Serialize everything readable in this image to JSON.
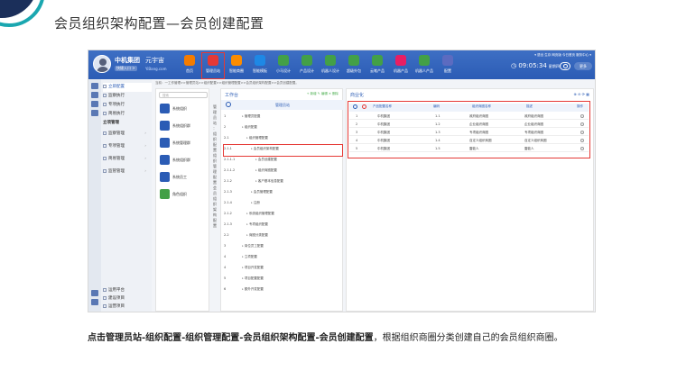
{
  "slide": {
    "title": "会员组织架构配置—会员创建配置",
    "caption_bold": "点击管理员站-组织配置-组织管理配置-会员组织架构配置-会员创建配置",
    "caption_rest": "，根据组织商圈分类创建自己的会员组织商圈。"
  },
  "app": {
    "company": "中机集团",
    "company_sub": "快捷入口 >",
    "logo": "元宇宙",
    "logo_sub": "YiBang.com",
    "header_links": "▾ 退出  生存  网页版  今日首页  服务中心 ▾",
    "clock": "09:05:34",
    "day": "星期四",
    "more": "更多",
    "nav": [
      {
        "label": "首页",
        "color": "#f57c00"
      },
      {
        "label": "管理员站",
        "color": "#e53935",
        "active": true
      },
      {
        "label": "智能商圈",
        "color": "#fb8c00"
      },
      {
        "label": "智能模板",
        "color": "#1e88e5"
      },
      {
        "label": "小马设计",
        "color": "#43a047"
      },
      {
        "label": "产品设计",
        "color": "#43a047"
      },
      {
        "label": "机器人设计",
        "color": "#43a047"
      },
      {
        "label": "超级外包",
        "color": "#43a047"
      },
      {
        "label": "云笔产品",
        "color": "#43a047"
      },
      {
        "label": "机器产品",
        "color": "#e91e63"
      },
      {
        "label": "机器人产品",
        "color": "#43a047"
      },
      {
        "label": "配置",
        "color": "#5c6bc0"
      }
    ]
  },
  "sidebar": {
    "items": [
      {
        "label": "立即配置",
        "active": true
      },
      {
        "label": "监察执行"
      },
      {
        "label": "专项执行"
      },
      {
        "label": "简易执行"
      },
      {
        "label": "立项管理",
        "header": true
      },
      {
        "label": "监察管理",
        "sub": true
      },
      {
        "label": "专项管理",
        "sub": true
      },
      {
        "label": "简易管理",
        "sub": true
      },
      {
        "label": "监管管理",
        "sub": true
      }
    ],
    "bottom": [
      {
        "label": "运用平台"
      },
      {
        "label": "建设项目"
      },
      {
        "label": "运营项目"
      }
    ]
  },
  "breadcrumb": "当前：一工作管理>>管理员站>>组织配置>>组织管理配置>>会员组织架构配置>>会员创建配置。",
  "left_panel": {
    "search_placeholder": "搜索",
    "items": [
      {
        "label": "系统组织",
        "green": false
      },
      {
        "label": "系统组织群",
        "green": false
      },
      {
        "label": "系统管理群",
        "green": false
      },
      {
        "label": "系统组织群",
        "green": false
      },
      {
        "label": "系统员工",
        "green": false
      },
      {
        "label": "角色组织",
        "green": true
      }
    ]
  },
  "vertical_text": "管理员站：组织配置组织管理配置会员组织架构配置",
  "work_panel": {
    "title": "工作台",
    "tools": "+ 新增 ✎ 编辑 ✕ 删除",
    "column": "管理员站",
    "rows": [
      {
        "n": "1",
        "t": "管理员配置",
        "indent": 1
      },
      {
        "n": "2",
        "t": "组织配置",
        "indent": 1
      },
      {
        "n": "2.1",
        "t": "组织管理配置",
        "indent": 2
      },
      {
        "n": "2.1.1",
        "t": "会员组织架构配置",
        "indent": 3
      },
      {
        "n": "2.1.1.1",
        "t": "会员创建配置",
        "indent": 4
      },
      {
        "n": "2.1.1.2",
        "t": "组织商圈配置",
        "indent": 4
      },
      {
        "n": "2.1.2",
        "t": "客户基本信息配置",
        "indent": 4
      },
      {
        "n": "2.1.3",
        "t": "会员管理配置",
        "indent": 3
      },
      {
        "n": "2.1.4",
        "t": "注册",
        "indent": 3
      },
      {
        "n": "2.1.2",
        "t": "系统组织管理配置",
        "indent": 2
      },
      {
        "n": "2.1.3",
        "t": "专项组织配置",
        "indent": 2
      },
      {
        "n": "2.2",
        "t": "商圈分类配置",
        "indent": 2
      },
      {
        "n": "3",
        "t": "岗位员工配置",
        "indent": 1
      },
      {
        "n": "4",
        "t": "立项配置",
        "indent": 1
      },
      {
        "n": "4",
        "t": "项目开发配置",
        "indent": 1
      },
      {
        "n": "5",
        "t": "项目配置配置",
        "indent": 1
      },
      {
        "n": "6",
        "t": "额外开发配置",
        "indent": 1
      }
    ]
  },
  "table_panel": {
    "title": "商业化",
    "tools": "⊕ ⊖ ⟳ ▦",
    "headers": [
      "产品配置名称",
      "编码",
      "组织商圈名称",
      "描述",
      "操作"
    ],
    "rows": [
      {
        "idx": "1",
        "name": "中机集团",
        "code": "1.1",
        "circle": "政府组织商圈",
        "desc": "政府组织商圈"
      },
      {
        "idx": "2",
        "name": "中机集团",
        "code": "1.2",
        "circle": "企业组织商圈",
        "desc": "企业组织商圈"
      },
      {
        "idx": "3",
        "name": "中机集团",
        "code": "1.3",
        "circle": "专项组织商圈",
        "desc": "专项组织商圈"
      },
      {
        "idx": "4",
        "name": "中机集团",
        "code": "1.4",
        "circle": "自定义组织商圈",
        "desc": "自定义组织商圈"
      },
      {
        "idx": "5",
        "name": "中机集团",
        "code": "1.5",
        "circle": "雷能人",
        "desc": "雷能人"
      }
    ]
  },
  "colors": {
    "accent": "#2b5cb5",
    "highlight": "#e53935"
  }
}
